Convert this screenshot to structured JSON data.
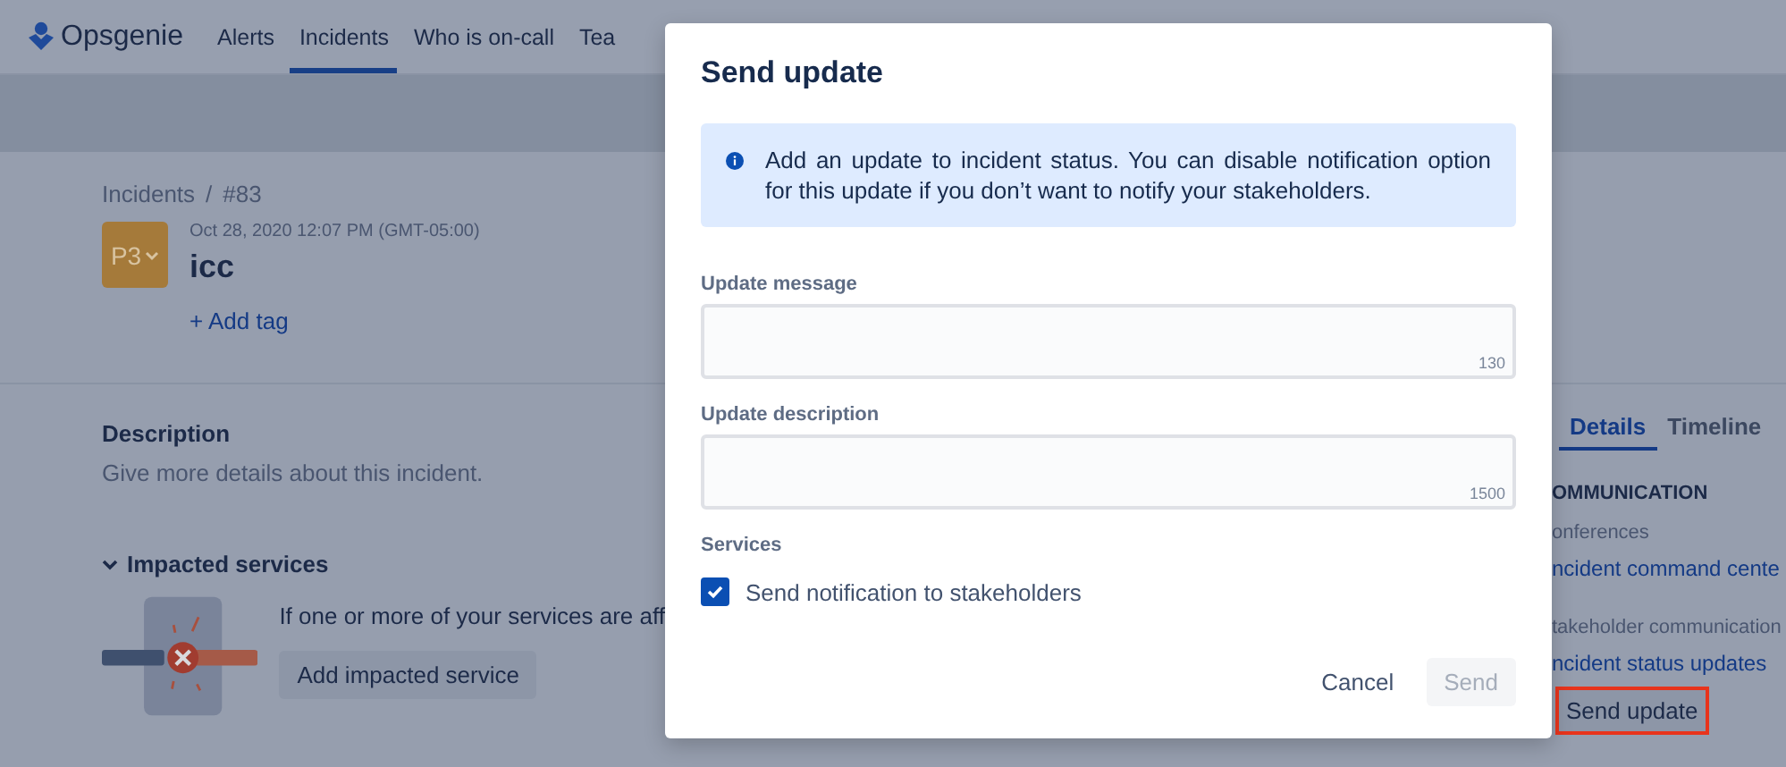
{
  "nav": {
    "logo": "Opsgenie",
    "items": [
      {
        "label": "Alerts",
        "selected": false
      },
      {
        "label": "Incidents",
        "selected": true
      },
      {
        "label": "Who is on-call",
        "selected": false
      },
      {
        "label": "Tea",
        "selected": false
      }
    ]
  },
  "incident": {
    "breadcrumb": [
      "Incidents",
      "#83"
    ],
    "breadcrumb_separator": "/",
    "priority": "P3",
    "timestamp": "Oct 28, 2020 12:07 PM (GMT-05:00)",
    "title": "icc",
    "add_tag": "+ Add tag"
  },
  "description": {
    "heading": "Description",
    "text": "Give more details about this incident."
  },
  "impacted_services": {
    "heading": "Impacted services",
    "expanded": true,
    "text": "If one or more of your services are aff",
    "button": "Add impacted service"
  },
  "side_panel": {
    "tabs": [
      {
        "label": "Details",
        "selected": true
      },
      {
        "label": "Timeline",
        "selected": false
      }
    ],
    "section": "OMMUNICATION",
    "groups": [
      {
        "label": "onferences",
        "links": [
          "ncident command cente"
        ]
      },
      {
        "label": "takeholder communication",
        "links": [
          "ncident status updates"
        ]
      }
    ],
    "action": {
      "label": "Send update",
      "highlighted": true
    }
  },
  "dialog": {
    "title": "Send update",
    "info": "Add an update to incident status. You can disable notification option for this update if you don’t want to notify your stakeholders.",
    "fields": [
      {
        "label": "Update message",
        "counter": "130"
      },
      {
        "label": "Update description",
        "counter": "1500"
      }
    ],
    "section": "Services",
    "checkbox": {
      "label": "Send notification to stakeholders",
      "checked": true
    },
    "buttons": [
      {
        "label": "Cancel",
        "kind": "subtle",
        "disabled": false
      },
      {
        "label": "Send",
        "kind": "primary",
        "disabled": true
      }
    ]
  }
}
